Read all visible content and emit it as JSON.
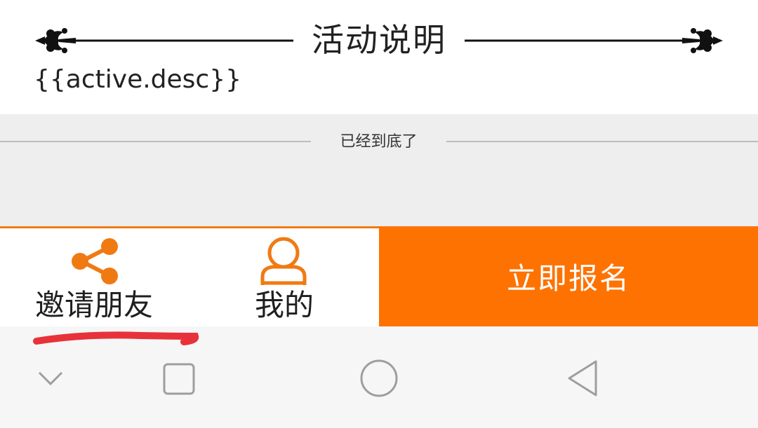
{
  "section": {
    "title": "活动说明",
    "description": "{{active.desc}}"
  },
  "footer": {
    "end_text": "已经到底了"
  },
  "actionbar": {
    "invite_label": "邀请朋友",
    "mine_label": "我的",
    "signup_label": "立即报名",
    "icons": {
      "invite": "share-icon",
      "mine": "user-icon"
    }
  },
  "navbar": {
    "icons": [
      "chevron-down-icon",
      "recents-square-icon",
      "home-circle-icon",
      "back-triangle-icon"
    ]
  },
  "colors": {
    "accent": "#fe7201",
    "accent_icon": "#f07a12",
    "annotation_mark": "#e8323a",
    "grey_bg": "#eeeeee",
    "navbar_bg": "#f6f6f6"
  }
}
